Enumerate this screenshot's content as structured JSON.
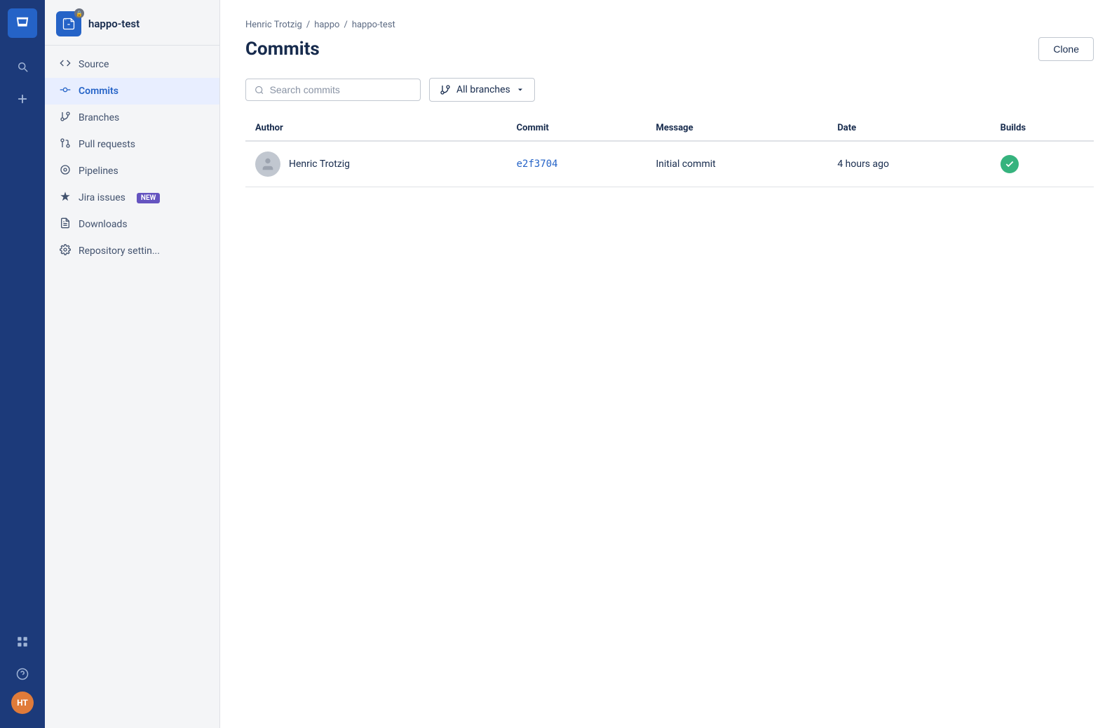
{
  "rail": {
    "logo_icon": "⊟",
    "search_icon": "🔍",
    "add_icon": "+",
    "grid_icon": "⊞",
    "help_icon": "?",
    "avatar_initials": "HT"
  },
  "sidebar": {
    "repo_name": "happo-test",
    "nav_items": [
      {
        "id": "source",
        "label": "Source",
        "icon": "<>"
      },
      {
        "id": "commits",
        "label": "Commits",
        "icon": "⎇",
        "active": true
      },
      {
        "id": "branches",
        "label": "Branches",
        "icon": "⑂"
      },
      {
        "id": "pull-requests",
        "label": "Pull requests",
        "icon": "⇄"
      },
      {
        "id": "pipelines",
        "label": "Pipelines",
        "icon": "◎"
      },
      {
        "id": "jira-issues",
        "label": "Jira issues",
        "icon": "◆",
        "badge": "NEW"
      },
      {
        "id": "downloads",
        "label": "Downloads",
        "icon": "☰"
      },
      {
        "id": "repository-settings",
        "label": "Repository settin...",
        "icon": "⚙"
      }
    ]
  },
  "main": {
    "breadcrumb": {
      "user": "Henric Trotzig",
      "repo_group": "happo",
      "repo_name": "happo-test"
    },
    "page_title": "Commits",
    "clone_button_label": "Clone",
    "search_placeholder": "Search commits",
    "branch_label": "All branches",
    "table": {
      "columns": [
        "Author",
        "Commit",
        "Message",
        "Date",
        "Builds"
      ],
      "rows": [
        {
          "author_name": "Henric Trotzig",
          "commit_hash": "e2f3704",
          "message": "Initial commit",
          "date": "4 hours ago",
          "build_status": "success"
        }
      ]
    }
  }
}
